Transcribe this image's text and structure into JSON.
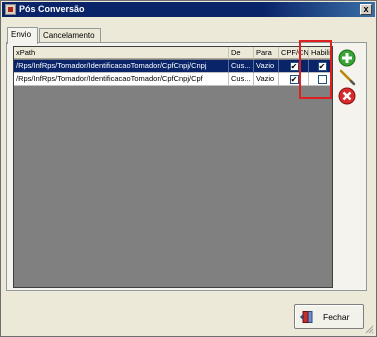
{
  "window": {
    "title": "Pós Conversão",
    "close_glyph": "x"
  },
  "tabs": [
    {
      "label": "Envio",
      "active": true
    },
    {
      "label": "Cancelamento",
      "active": false
    }
  ],
  "grid": {
    "columns": [
      "xPath",
      "De",
      "Para",
      "CPF/CNPJ",
      "Habilitado"
    ],
    "rows": [
      {
        "xpath": "/Rps/InfRps/Tomador/IdentificacaoTomador/CpfCnpj/Cnpj",
        "de": "Cus...",
        "para": "Vazio",
        "cpf_cnpj": true,
        "habilitado": true,
        "selected": true
      },
      {
        "xpath": "/Rps/InfRps/Tomador/IdentificacaoTomador/CpfCnpj/Cpf",
        "de": "Cus...",
        "para": "Vazio",
        "cpf_cnpj": true,
        "habilitado": false,
        "selected": false
      }
    ],
    "check_glyph": "✔"
  },
  "actions": {
    "add_icon": "plus-circle-icon",
    "edit_icon": "pencil-icon",
    "remove_icon": "remove-circle-icon"
  },
  "footer": {
    "fechar_label": "Fechar"
  },
  "colors": {
    "title_bar": "#0a246a",
    "selected_row": "#0a246a",
    "highlight_box": "#e02020",
    "add_green": "#3aa335",
    "remove_red": "#d62b2b"
  }
}
